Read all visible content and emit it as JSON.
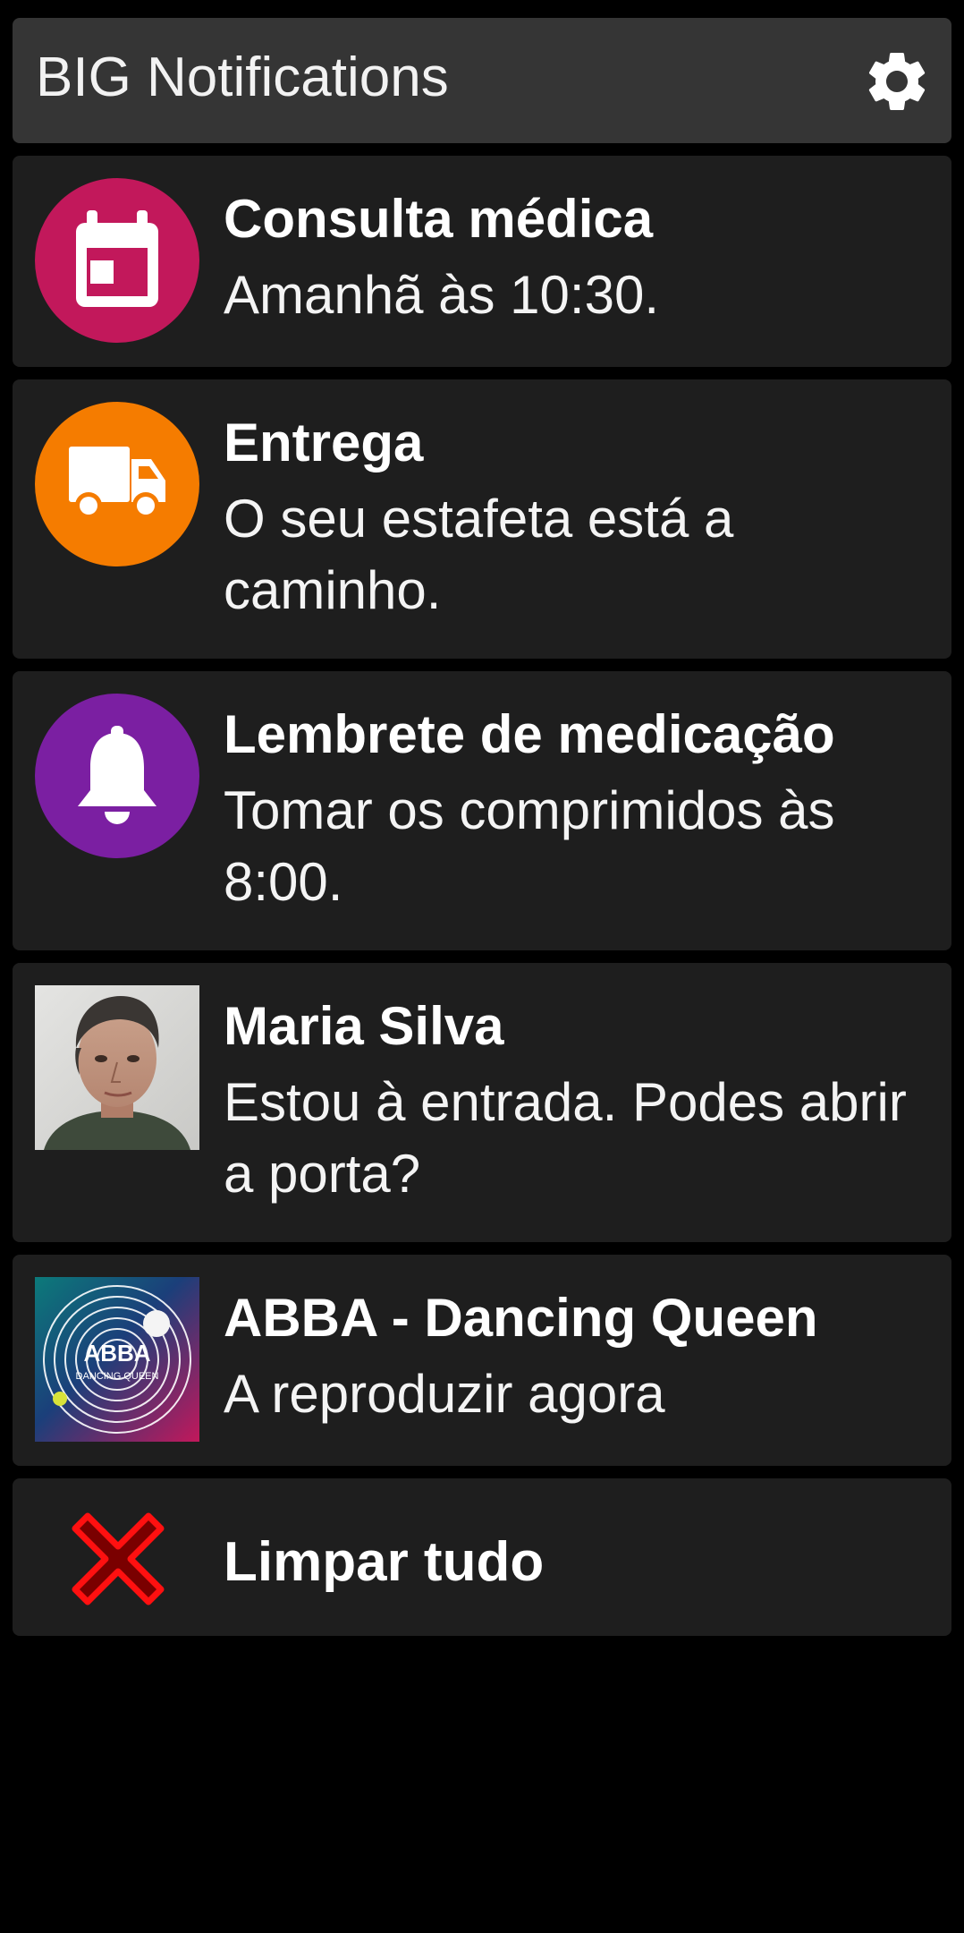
{
  "app": {
    "title": "BIG Notifications",
    "settings_icon": "gear-icon"
  },
  "notifications": [
    {
      "title": "Consulta médica",
      "body": "Amanhã às 10:30.",
      "icon": "calendar-icon",
      "icon_color": "#c2185b"
    },
    {
      "title": "Entrega",
      "body": "O seu estafeta está a caminho.",
      "icon": "truck-icon",
      "icon_color": "#f57c00"
    },
    {
      "title": "Lembrete de medicação",
      "body": "Tomar os comprimidos às 8:00.",
      "icon": "bell-icon",
      "icon_color": "#7b1fa2"
    },
    {
      "title": "Maria Silva",
      "body": "Estou à entrada. Podes abrir a porta?",
      "icon": "contact-photo"
    },
    {
      "title": "ABBA - Dancing Queen",
      "body": "A reproduzir agora",
      "icon": "album-art",
      "album_art_text": "ABBA",
      "album_art_subtext": "DANCING QUEEN"
    }
  ],
  "clear_all": {
    "label": "Limpar tudo",
    "icon": "close-x-icon",
    "icon_color": "#e00000"
  }
}
